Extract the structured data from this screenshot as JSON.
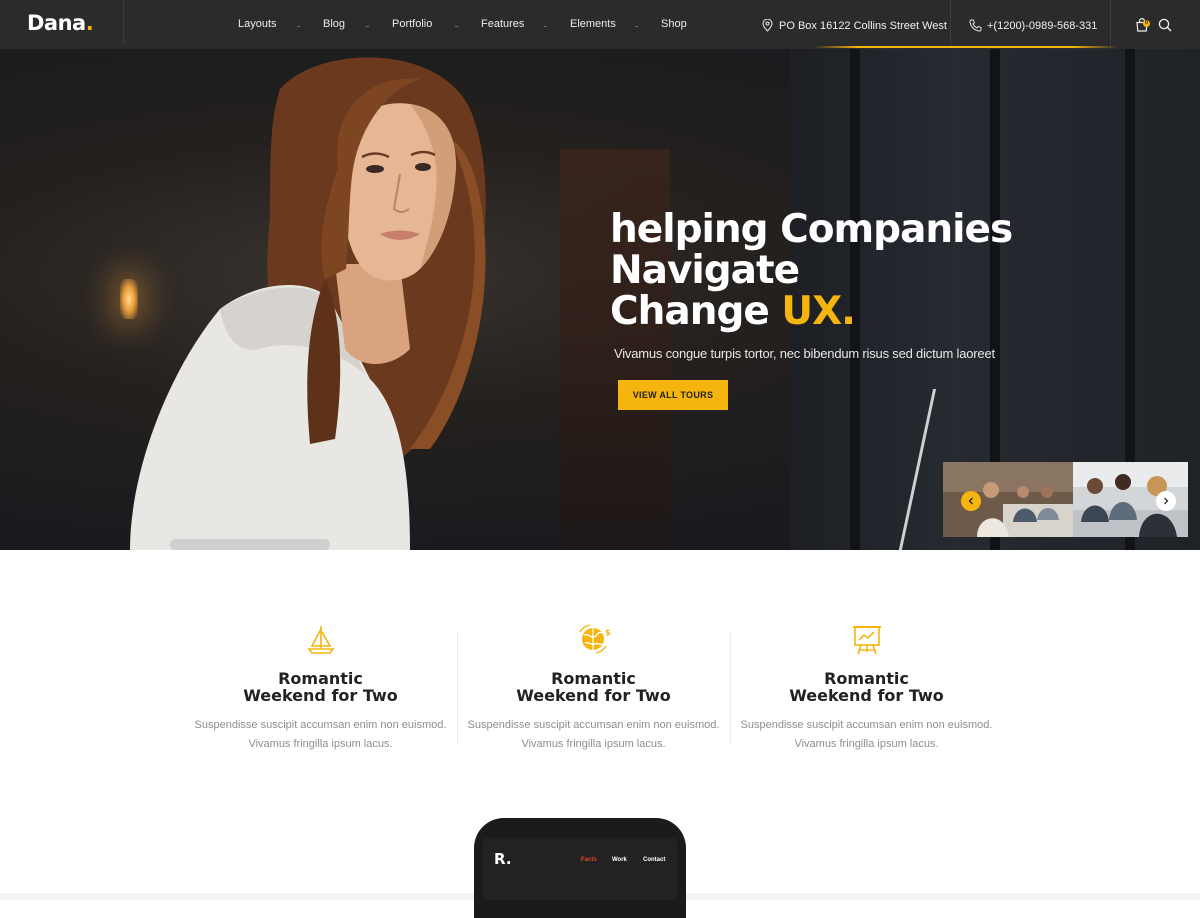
{
  "header": {
    "logo": {
      "text": "Dana",
      "dot": "."
    },
    "nav": [
      "Layouts",
      "Blog",
      "Portfolio",
      "Features",
      "Elements",
      "Shop"
    ],
    "address": "PO Box 16122 Collins Street West",
    "phone": "+(1200)-0989-568-331",
    "cart_count": "0",
    "icons": {
      "address": "map-pin-icon",
      "phone": "phone-icon",
      "cart": "shopping-bag-icon",
      "search": "search-icon"
    }
  },
  "hero": {
    "title_line1": "helping Companies",
    "title_line2": "Navigate",
    "title_line3": "Change",
    "title_accent": "UX.",
    "subtitle": "Vivamus congue turpis tortor, nec bibendum risus sed dictum laoreet",
    "button": "VIEW ALL TOURS"
  },
  "slider": {
    "prev_icon": "chevron-left-icon",
    "next_icon": "chevron-right-icon"
  },
  "features": [
    {
      "icon": "sailboat-icon",
      "title_line1": "Romantic",
      "title_line2": "Weekend for Two",
      "text_line1": "Suspendisse suscipit accumsan enim non euismod.",
      "text_line2": "Vivamus fringilla ipsum lacus."
    },
    {
      "icon": "globe-money-icon",
      "title_line1": "Romantic",
      "title_line2": "Weekend for Two",
      "text_line1": "Suspendisse suscipit accumsan enim non euismod.",
      "text_line2": "Vivamus fringilla ipsum lacus."
    },
    {
      "icon": "presentation-board-icon",
      "title_line1": "Romantic",
      "title_line2": "Weekend for Two",
      "text_line1": "Suspendisse suscipit accumsan enim non euismod.",
      "text_line2": "Vivamus fringilla ipsum lacus."
    }
  ],
  "phone_preview": {
    "logo": "R.",
    "nav": [
      "Facts",
      "Work",
      "Contact"
    ]
  },
  "colors": {
    "accent": "#f6b40e",
    "header_bg": "#2b2b2b",
    "phone_active": "#e8452c"
  }
}
